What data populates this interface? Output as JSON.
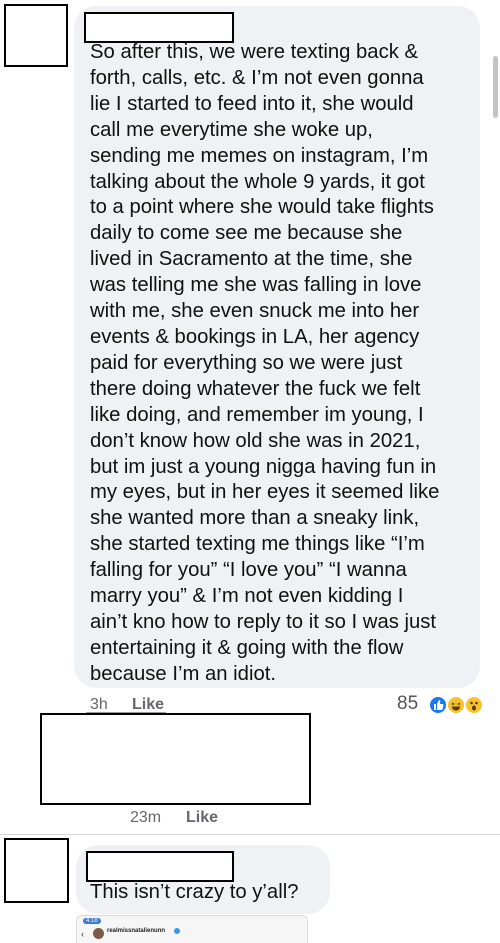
{
  "comment1": {
    "lines": [
      "So after this, we were texting back &",
      "forth, calls, etc. & I’m not even gonna",
      "lie I started to feed into it, she would",
      "call me everytime she woke up,",
      "sending me memes on instagram, I’m",
      "talking about the whole 9 yards, it got",
      "to a point where she would take flights",
      "daily to come see me because she",
      "lived in Sacramento at the time, she",
      "was telling me she was falling in love",
      "with me, she even snuck me into her",
      "events & bookings in LA, her agency",
      "paid for everything so we were just",
      "there doing whatever the fuck we felt",
      "like doing, and remember im young, I",
      "don’t know how old she was in 2021,",
      "but im just a young nigga having fun in",
      "my eyes, but in her eyes it seemed like",
      "she wanted more than a sneaky link,",
      "she started texting me things like “I’m",
      "falling for you” “I love you” “I wanna",
      "marry you” & I’m not even kidding I",
      "ain’t kno how to reply to it so I was just",
      "entertaining it & going with the flow",
      "because I’m an idiot."
    ],
    "time": "3h",
    "like_label": "Like",
    "reaction_count": "85",
    "reactions": [
      "like",
      "haha",
      "wow"
    ]
  },
  "comment2": {
    "time": "23m",
    "like_label": "Like"
  },
  "comment3": {
    "text": "This isn’t crazy to y’all?"
  },
  "embedded": {
    "username": "realmissnatalienunn",
    "time": "4:18"
  },
  "colors": {
    "bubble": "#f0f1f4",
    "meta": "#65676b",
    "like_blue": "#1877f2",
    "emoji_yellow": "#f7c22f"
  }
}
